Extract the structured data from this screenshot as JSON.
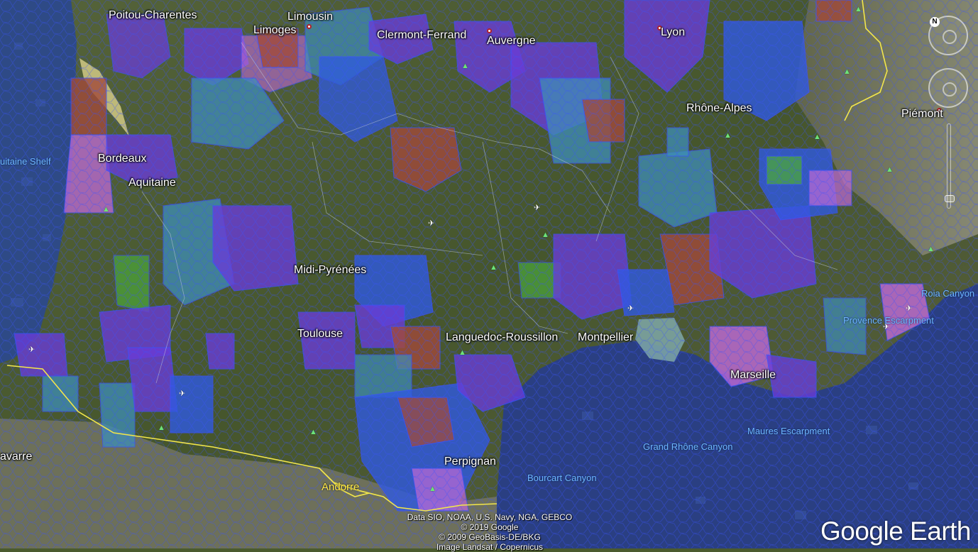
{
  "labels": {
    "regions": [
      "Poitou-Charentes",
      "Limousin",
      "Auvergne",
      "Aquitaine",
      "Midi-Pyrénées",
      "Languedoc-Roussillon",
      "Rhône-Alpes"
    ],
    "cities": [
      "Limoges",
      "Clermont-Ferrand",
      "Lyon",
      "Bordeaux",
      "Toulouse",
      "Montpellier",
      "Marseille",
      "Perpignan",
      "Piémont"
    ],
    "edge": [
      "avarre"
    ],
    "countries": [
      "Andorre"
    ],
    "sea_features": [
      "uitaine Shelf",
      "Grand Rhône Canyon",
      "Bourcart Canyon",
      "Maures Escarpment",
      "Provence Escarpment",
      "Roia Canyon"
    ]
  },
  "attribution": [
    "Data SIO, NOAA, U.S. Navy, NGA, GEBCO",
    "© 2019 Google",
    "© 2009 GeoBasis-DE/BKG",
    "Image Landsat / Copernicus"
  ],
  "watermark": "Google Earth",
  "compass": {
    "north_label": "N"
  },
  "colors": {
    "terrain": "#4a5a2e",
    "sea": "#2a3f82",
    "border": "#f2e64b",
    "overlay_purple": "#6a3cd6",
    "overlay_blue": "#2f5ae0",
    "overlay_teal": "#3e8fb8",
    "overlay_brown": "#a24a3a",
    "overlay_magenta": "#c06ad8",
    "overlay_green": "#4ba83a"
  },
  "icons": [
    "tree-icon",
    "airport-icon",
    "compass-icon",
    "zoom-slider"
  ]
}
